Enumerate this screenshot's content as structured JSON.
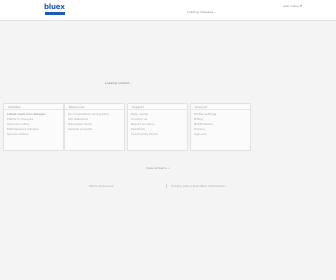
{
  "header": {
    "logo_text": "bluex",
    "nav_text": "Loading message...",
    "account_label": "user menu"
  },
  "hero": {
    "status_text": "Loading content..."
  },
  "panels": [
    {
      "title": "Updates",
      "lines": [
        "Latest news and releases",
        "Platform changes",
        "Security notice",
        "Maintenance window",
        "Service status"
      ]
    },
    {
      "title": "Resources",
      "lines": [
        "Documentation and guides",
        "API reference",
        "Developer tools",
        "Sample projects"
      ]
    },
    {
      "title": "Support",
      "lines": [
        "Help center",
        "Contact us",
        "Report an issue",
        "Feedback",
        "Community forum"
      ]
    },
    {
      "title": "Account",
      "lines": [
        "Profile settings",
        "Billing",
        "Notifications",
        "Privacy",
        "Sign out"
      ]
    }
  ],
  "links": {
    "mid_link": "View all items »",
    "footer_left": "Terms of service",
    "footer_right": "Privacy policy and other information"
  }
}
